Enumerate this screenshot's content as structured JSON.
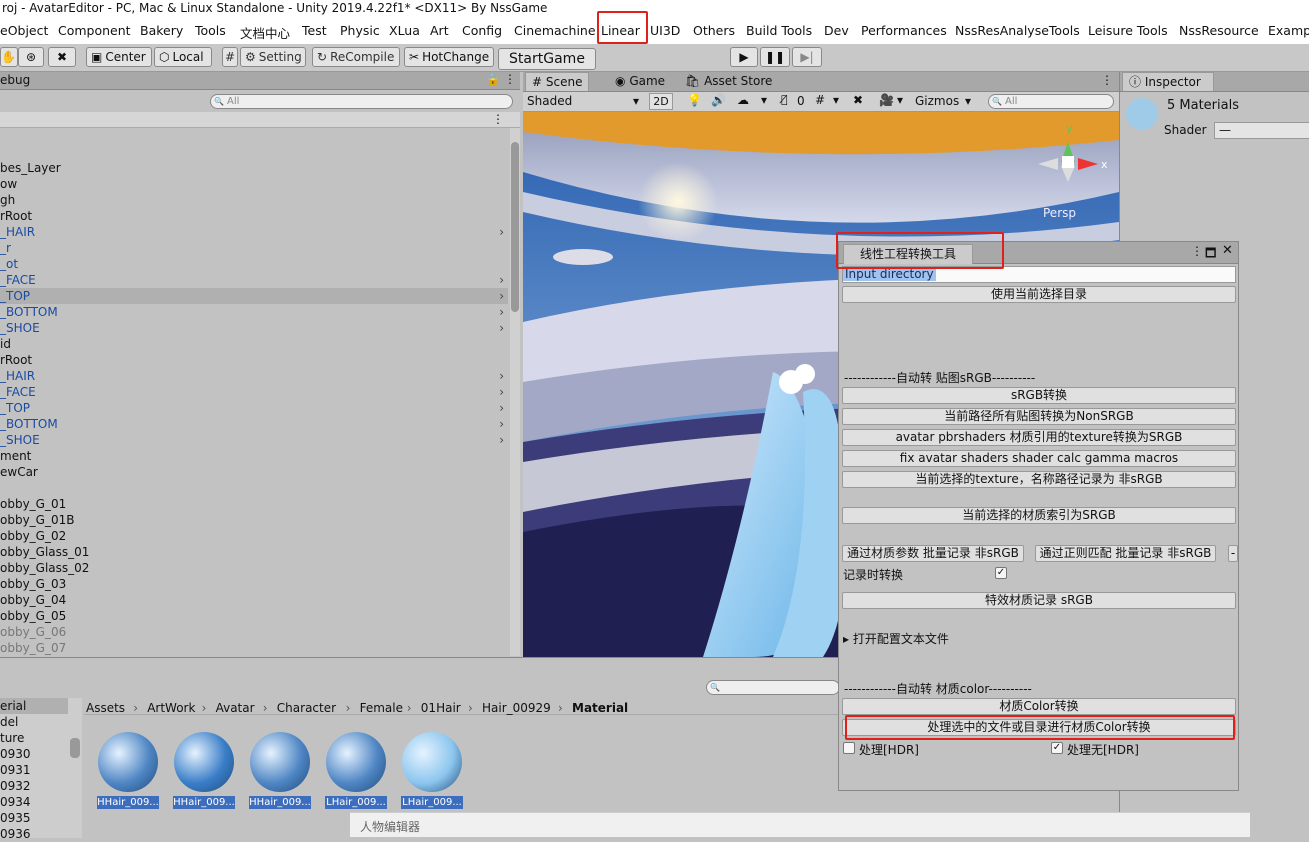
{
  "window_title": "roj - AvatarEditor - PC, Mac & Linux Standalone - Unity 2019.4.22f1* <DX11> By NssGame",
  "menu": [
    "eObject",
    "Component",
    "Bakery",
    "Tools",
    "文档中心",
    "Test",
    "Physic",
    "XLua",
    "Art",
    "Config",
    "Cinemachine",
    "Linear",
    "UI3D",
    "Others",
    "Build Tools",
    "Dev",
    "Performances",
    "NssResAnalyseTools",
    "Leisure Tools",
    "NssResource",
    "Examp"
  ],
  "toolbar": {
    "center": "Center",
    "local": "Local",
    "setting": "Setting",
    "recompile": "ReCompile",
    "hotchange": "HotChange",
    "startgame": "StartGame"
  },
  "hierarchy": {
    "title": "ebug",
    "search_placeholder": "All",
    "rows": [
      {
        "t": "",
        "c": "n"
      },
      {
        "t": "",
        "c": "n"
      },
      {
        "t": "bes_Layer",
        "c": "n"
      },
      {
        "t": "ow",
        "c": "n"
      },
      {
        "t": "gh",
        "c": "n"
      },
      {
        "t": "rRoot",
        "c": "n"
      },
      {
        "t": "HAIR",
        "c": "b",
        "x": 1
      },
      {
        "t": "r",
        "c": "b"
      },
      {
        "t": "ot",
        "c": "b"
      },
      {
        "t": "FACE",
        "c": "b",
        "x": 1
      },
      {
        "t": "TOP",
        "c": "b",
        "x": 1,
        "sel": 1
      },
      {
        "t": "BOTTOM",
        "c": "b",
        "x": 1
      },
      {
        "t": "SHOE",
        "c": "b",
        "x": 1
      },
      {
        "t": "id",
        "c": "n"
      },
      {
        "t": "rRoot",
        "c": "n"
      },
      {
        "t": "HAIR",
        "c": "b",
        "x": 1
      },
      {
        "t": "FACE",
        "c": "b",
        "x": 1
      },
      {
        "t": "TOP",
        "c": "b",
        "x": 1
      },
      {
        "t": "BOTTOM",
        "c": "b",
        "x": 1
      },
      {
        "t": "SHOE",
        "c": "b",
        "x": 1
      },
      {
        "t": "ment",
        "c": "n"
      },
      {
        "t": "ewCar",
        "c": "n"
      },
      {
        "t": "",
        "c": "n"
      },
      {
        "t": "obby_G_01",
        "c": "n"
      },
      {
        "t": "obby_G_01B",
        "c": "n"
      },
      {
        "t": "obby_G_02",
        "c": "n"
      },
      {
        "t": "obby_Glass_01",
        "c": "n"
      },
      {
        "t": "obby_Glass_02",
        "c": "n"
      },
      {
        "t": "obby_G_03",
        "c": "n"
      },
      {
        "t": "obby_G_04",
        "c": "n"
      },
      {
        "t": "obby_G_05",
        "c": "n"
      },
      {
        "t": "obby_G_06",
        "c": "g"
      },
      {
        "t": "obby_G_07",
        "c": "g"
      }
    ]
  },
  "scene_tabs": {
    "scene": "Scene",
    "game": "Game",
    "asset_store": "Asset Store"
  },
  "scene_toolbar": {
    "shading": "Shaded",
    "mode2d": "2D",
    "hidden_count": "0",
    "gizmos": "Gizmos",
    "search": "All",
    "persp": "Persp"
  },
  "inspector": {
    "tab": "Inspector",
    "title": "5 Materials",
    "shader_label": "Shader",
    "shader_value": "—"
  },
  "tool_window": {
    "tab": "线性工程转换工具",
    "input_placeholder": "Input directory",
    "btn_use_dir": "使用当前选择目录",
    "sec1": "------------自动转 贴图sRGB----------",
    "btn_srgb": "sRGB转换",
    "btn_nonsrgb": "当前路径所有贴图转换为NonSRGB",
    "btn_pbr": "avatar pbrshaders 材质引用的texture转换为SRGB",
    "btn_fix": "fix avatar shaders shader calc gamma macros",
    "btn_record": "当前选择的texture，名称路径记录为 非sRGB",
    "btn_mat_index": "当前选择的材质索引为SRGB",
    "btn_batch1": "通过材质参数 批量记录 非sRGB",
    "btn_batch2": "通过正则匹配 批量记录 非sRGB",
    "btn_batch3": "-",
    "convert_on_record": "记录时转换",
    "btn_effect": "特效材质记录 sRGB",
    "open_config": "打开配置文本文件",
    "sec2": "------------自动转 材质color----------",
    "btn_color": "材质Color转换",
    "btn_color_sel": "处理选中的文件或目录进行材质Color转换",
    "hdr": "处理[HDR]",
    "nohdr": "处理无[HDR]"
  },
  "project": {
    "tree": [
      "erial",
      "del",
      "ture",
      "0930",
      "0931",
      "0932",
      "0934",
      "0935",
      "0936"
    ],
    "breadcrumb": [
      "Assets",
      "ArtWork",
      "Avatar",
      "Character",
      "Female",
      "01Hair",
      "Hair_00929",
      "Material"
    ],
    "assets": [
      "HHair_009...",
      "HHair_009...",
      "HHair_009...",
      "LHair_009...",
      "LHair_009..."
    ]
  },
  "bottom_window": "人物编辑器",
  "accent_red": "#e0201a",
  "selection_blue": "#3d6ebd"
}
